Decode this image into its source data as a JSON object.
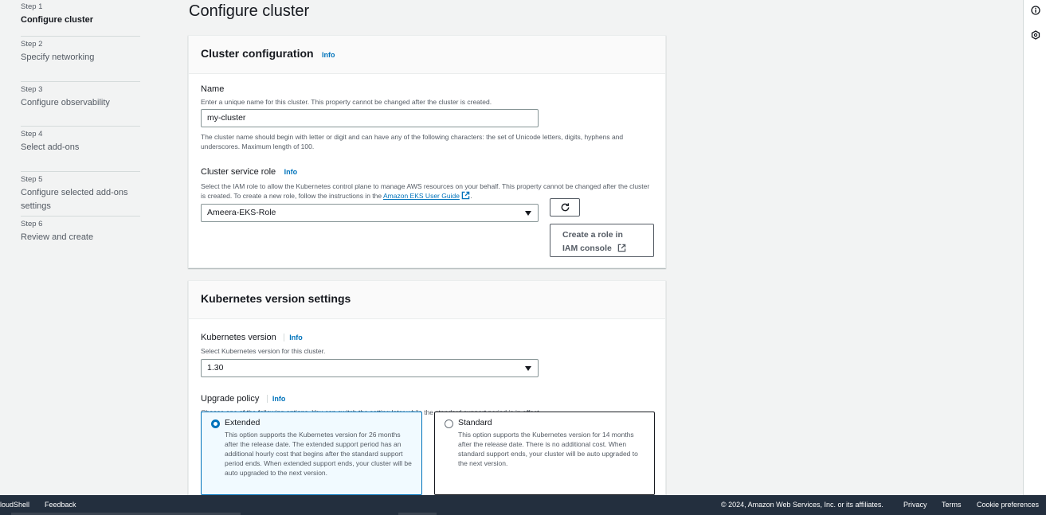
{
  "steps": [
    {
      "num": "Step 1",
      "label": "Configure cluster",
      "active": true
    },
    {
      "num": "Step 2",
      "label": "Specify networking"
    },
    {
      "num": "Step 3",
      "label": "Configure observability"
    },
    {
      "num": "Step 4",
      "label": "Select add-ons"
    },
    {
      "num": "Step 5",
      "label": "Configure selected add-ons settings"
    },
    {
      "num": "Step 6",
      "label": "Review and create"
    }
  ],
  "page_title": "Configure cluster",
  "cluster_config": {
    "title": "Cluster configuration",
    "info": "Info",
    "name_label": "Name",
    "name_desc": "Enter a unique name for this cluster. This property cannot be changed after the cluster is created.",
    "name_value": "my-cluster",
    "name_constraint": "The cluster name should begin with letter or digit and can have any of the following characters: the set of Unicode letters, digits, hyphens and underscores. Maximum length of 100.",
    "role_label": "Cluster service role",
    "role_info": "Info",
    "role_desc": "Select the IAM role to allow the Kubernetes control plane to manage AWS resources on your behalf. This property cannot be changed after the cluster is created. To create a new role, follow the instructions in the",
    "role_link": "Amazon EKS User Guide",
    "role_value": "Ameera-EKS-Role",
    "create_role_line1": "Create a role in",
    "create_role_line2": "IAM console"
  },
  "k8s": {
    "title": "Kubernetes version settings",
    "version_label": "Kubernetes version",
    "version_info": "Info",
    "version_desc": "Select Kubernetes version for this cluster.",
    "version_value": "1.30",
    "policy_label": "Upgrade policy",
    "policy_info": "Info",
    "policy_desc": "Choose one of the following options. You can switch the setting later while the standard support period is in effect.",
    "extended_title": "Extended",
    "extended_desc": "This option supports the Kubernetes version for 26 months after the release date. The extended support period has an additional hourly cost that begins after the standard support period ends. When extended support ends, your cluster will be auto upgraded to the next version.",
    "standard_title": "Standard",
    "standard_desc": "This option supports the Kubernetes version for 14 months after the release date. There is no additional cost. When standard support ends, your cluster will be auto upgraded to the next version."
  },
  "footer": {
    "cloudshell": "loudShell",
    "feedback": "Feedback",
    "copyright": "© 2024, Amazon Web Services, Inc. or its affiliates.",
    "privacy": "Privacy",
    "terms": "Terms",
    "cookie": "Cookie preferences"
  },
  "icons": {
    "info_rail": "info-circle-icon",
    "settings_rail": "hexagon-settings-icon",
    "refresh": "refresh-icon",
    "external": "external-link-icon"
  },
  "colors": {
    "accent": "#0073bb",
    "footer_bg": "#232f3e",
    "page_bg": "#f2f3f3"
  }
}
